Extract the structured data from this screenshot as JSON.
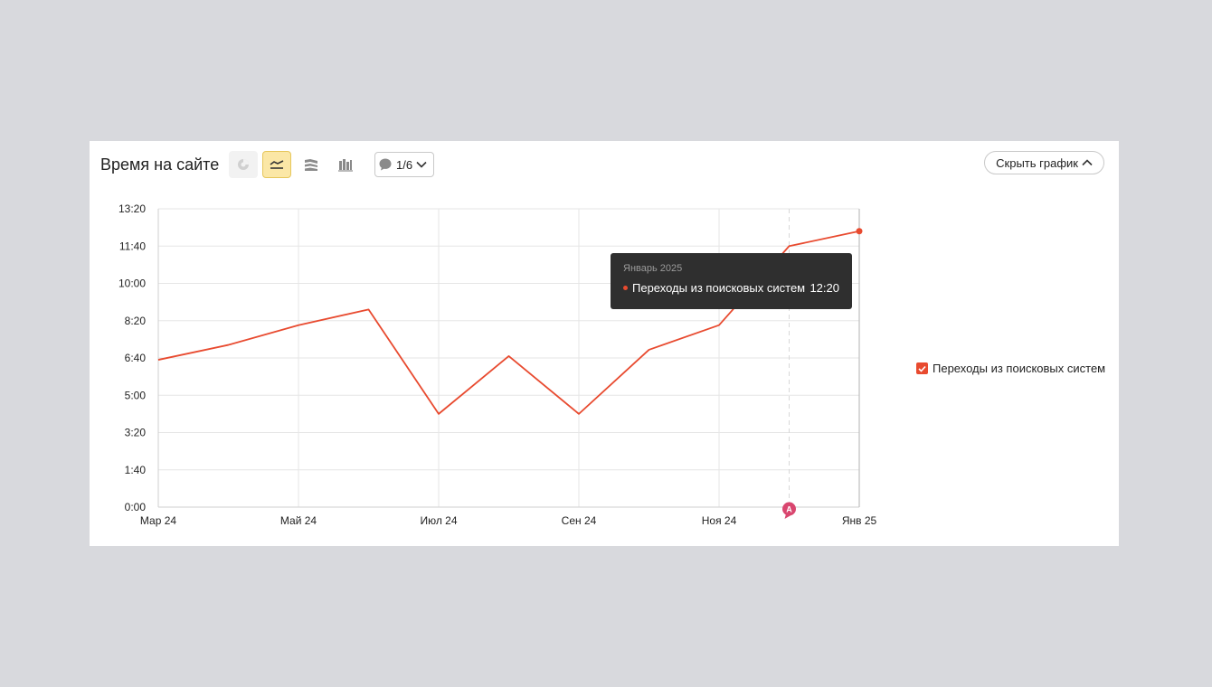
{
  "header": {
    "title": "Время на сайте",
    "annotations_counter": "1/6",
    "hide_chart_label": "Скрыть график"
  },
  "chart_toolbar": {
    "icons": [
      "pie-chart-icon",
      "line-chart-icon",
      "area-chart-icon",
      "bar-chart-icon"
    ],
    "active": "line-chart-icon"
  },
  "tooltip": {
    "date": "Январь 2025",
    "series": "Переходы из поисковых систем",
    "value": "12:20"
  },
  "legend": {
    "label": "Переходы из поисковых систем",
    "checked": true
  },
  "annotation_marker": "A",
  "colors": {
    "series": "#e84a2f",
    "active_tool_bg": "#fbe7a6",
    "tooltip_bg": "#2f2f2f",
    "annotation": "#d9466f"
  },
  "chart_data": {
    "type": "line",
    "title": "Время на сайте",
    "y_unit": "minutes:seconds",
    "ylim": [
      0,
      800
    ],
    "y_ticks": [
      0,
      100,
      200,
      300,
      400,
      500,
      600,
      700,
      800
    ],
    "y_tick_labels": [
      "0:00",
      "1:40",
      "3:20",
      "5:00",
      "6:40",
      "8:20",
      "10:00",
      "11:40",
      "13:20"
    ],
    "x": [
      "2024-03",
      "2024-04",
      "2024-05",
      "2024-06",
      "2024-07",
      "2024-08",
      "2024-09",
      "2024-10",
      "2024-11",
      "2024-12",
      "2025-01"
    ],
    "x_tick_labels": [
      "Мар 24",
      "Май 24",
      "Июл 24",
      "Сен 24",
      "Ноя 24",
      "Янв 25"
    ],
    "x_tick_positions": [
      "2024-03",
      "2024-05",
      "2024-07",
      "2024-09",
      "2024-11",
      "2025-01"
    ],
    "series": [
      {
        "name": "Переходы из поисковых систем",
        "values": [
          395,
          435,
          488,
          530,
          250,
          405,
          250,
          422,
          488,
          700,
          740
        ]
      }
    ],
    "highlight": {
      "x": "2025-01",
      "value_label": "12:20"
    },
    "annotation_x": "2024-12",
    "grid": true,
    "legend_position": "right"
  }
}
